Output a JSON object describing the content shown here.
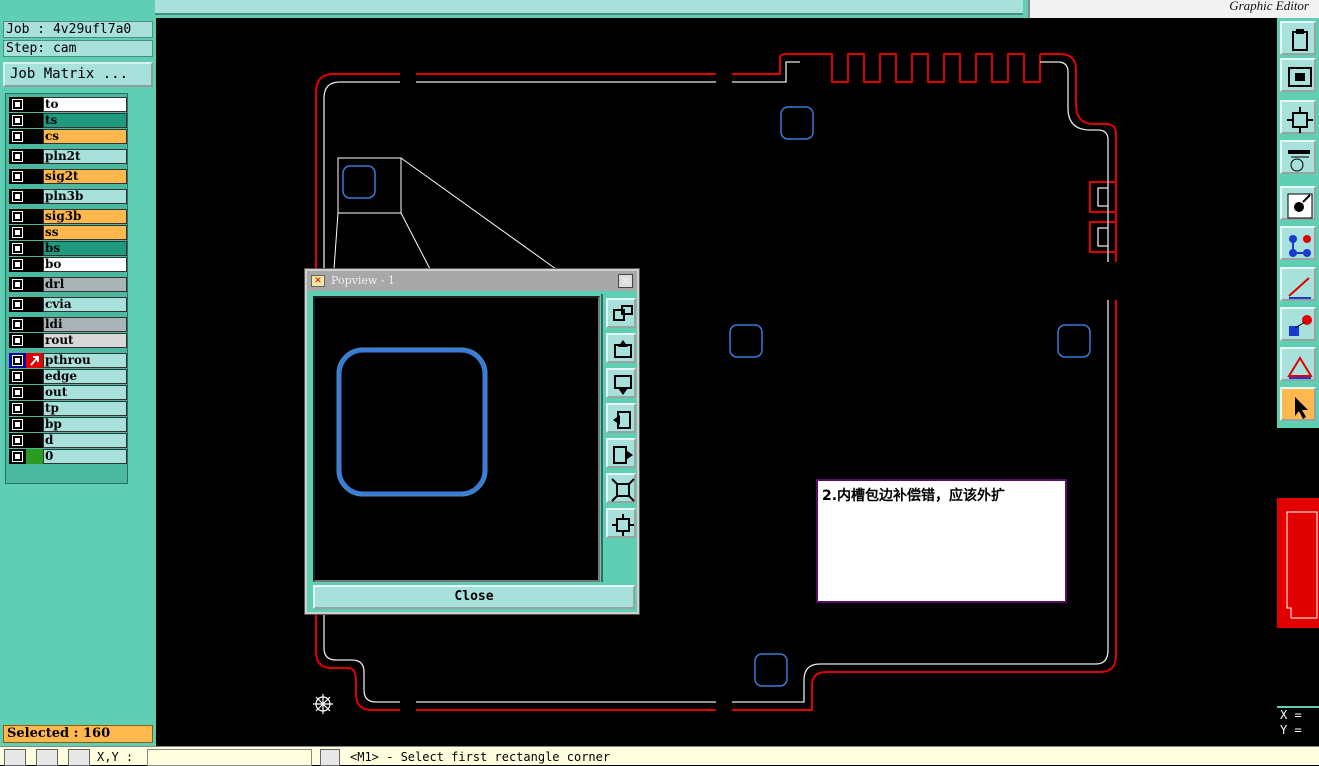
{
  "app": {
    "brand_tagline": "Graphic Editor"
  },
  "job": {
    "job_line": "Job : 4v29ufl7a0",
    "step_line": "Step: cam",
    "matrix_button": "Job Matrix ..."
  },
  "layers": [
    {
      "name": "to",
      "color": "#ffffff"
    },
    {
      "name": "ts",
      "color": "#1f9a7e"
    },
    {
      "name": "cs",
      "color": "#ffb84d"
    },
    {
      "name": "pln2t",
      "color": "#a8e0dc"
    },
    {
      "name": "sig2t",
      "color": "#ffb84d"
    },
    {
      "name": "pln3b",
      "color": "#a8e0dc"
    },
    {
      "name": "sig3b",
      "color": "#ffb84d"
    },
    {
      "name": "ss",
      "color": "#ffb84d"
    },
    {
      "name": "bs",
      "color": "#1f9a7e"
    },
    {
      "name": "bo",
      "color": "#ffffff"
    },
    {
      "name": "drl",
      "color": "#a9b4b8"
    },
    {
      "name": "cvia",
      "color": "#a8e0dc"
    },
    {
      "name": "ldi",
      "color": "#a9b4b8"
    },
    {
      "name": "rout",
      "color": "#d8d8d8"
    },
    {
      "name": "pthrou",
      "color": "#a8e0dc"
    },
    {
      "name": "edge",
      "color": "#a8e0dc"
    },
    {
      "name": "out",
      "color": "#a8e0dc"
    },
    {
      "name": "tp",
      "color": "#a8e0dc"
    },
    {
      "name": "bp",
      "color": "#a8e0dc"
    },
    {
      "name": "d",
      "color": "#a8e0dc"
    },
    {
      "name": "0",
      "color": "#a8e0dc"
    }
  ],
  "selected_text": "Selected : 160",
  "coords": {
    "x_label": "X =",
    "y_label": "Y ="
  },
  "status": {
    "xy_label": "X,Y :",
    "message": "<M1> - Select first rectangle corner"
  },
  "popview": {
    "title": "Popview - 1",
    "close_button": "Close"
  },
  "annotation": {
    "text": "2.内槽包边补偿错，应该外扩"
  },
  "colors": {
    "panel": "#5ecfb2",
    "panel_light": "#a8e0dc",
    "outline_red": "#e00000",
    "slot_blue": "#3a7ad8",
    "selected": "#ffb84d"
  },
  "icons": {
    "right_toolbar": [
      "clipboard-icon",
      "fit-window-icon",
      "zoom-fit-icon",
      "palette-tools-icon",
      "snap-icon",
      "connect-nodes-icon",
      "measure-icon",
      "select-feature-icon",
      "triangle-tool-icon",
      "pointer-icon"
    ],
    "popview_toolbar": [
      "zoom-window-icon",
      "pan-up-icon",
      "pan-down-icon",
      "pan-left-icon",
      "pan-right-icon",
      "zoom-in-icon",
      "zoom-out-icon"
    ]
  }
}
